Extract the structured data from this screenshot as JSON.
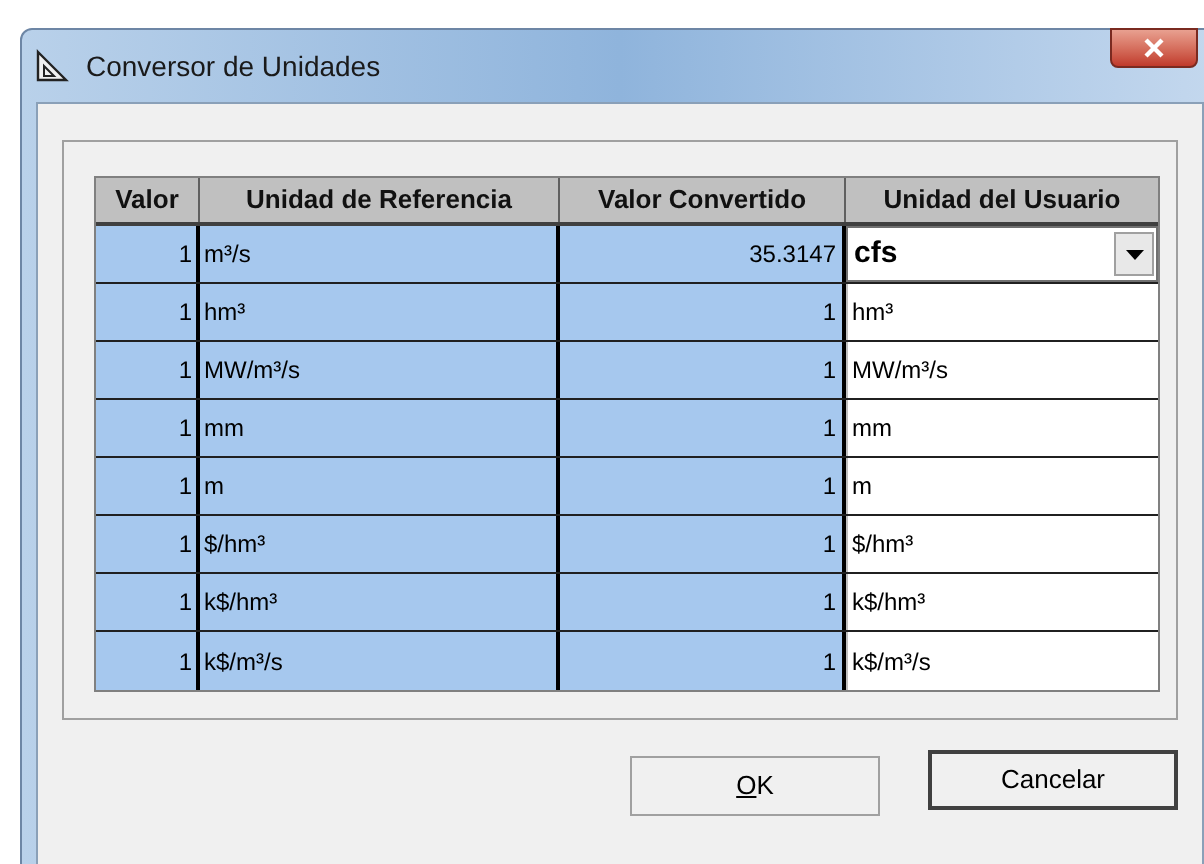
{
  "window": {
    "title": "Conversor de Unidades"
  },
  "table": {
    "columns": [
      "Valor",
      "Unidad de Referencia",
      "Valor Convertido",
      "Unidad del Usuario"
    ],
    "rows": [
      {
        "value": "1",
        "reference_unit": "m³/s",
        "converted": "35.3147",
        "user_unit": "cfs",
        "kind": "dropdown"
      },
      {
        "value": "1",
        "reference_unit": "hm³",
        "converted": "1",
        "user_unit": "hm³",
        "kind": "text"
      },
      {
        "value": "1",
        "reference_unit": "MW/m³/s",
        "converted": "1",
        "user_unit": "MW/m³/s",
        "kind": "text"
      },
      {
        "value": "1",
        "reference_unit": "mm",
        "converted": "1",
        "user_unit": "mm",
        "kind": "text"
      },
      {
        "value": "1",
        "reference_unit": "m",
        "converted": "1",
        "user_unit": "m",
        "kind": "text"
      },
      {
        "value": "1",
        "reference_unit": "$/hm³",
        "converted": "1",
        "user_unit": "$/hm³",
        "kind": "text"
      },
      {
        "value": "1",
        "reference_unit": "k$/hm³",
        "converted": "1",
        "user_unit": "k$/hm³",
        "kind": "text"
      },
      {
        "value": "1",
        "reference_unit": "k$/m³/s",
        "converted": "1",
        "user_unit": "k$/m³/s",
        "kind": "text"
      }
    ]
  },
  "buttons": [
    {
      "label": "OK",
      "mnemonic_underlined": true,
      "default": false
    },
    {
      "label": "Cancelar",
      "mnemonic_underlined": false,
      "default": true
    }
  ]
}
